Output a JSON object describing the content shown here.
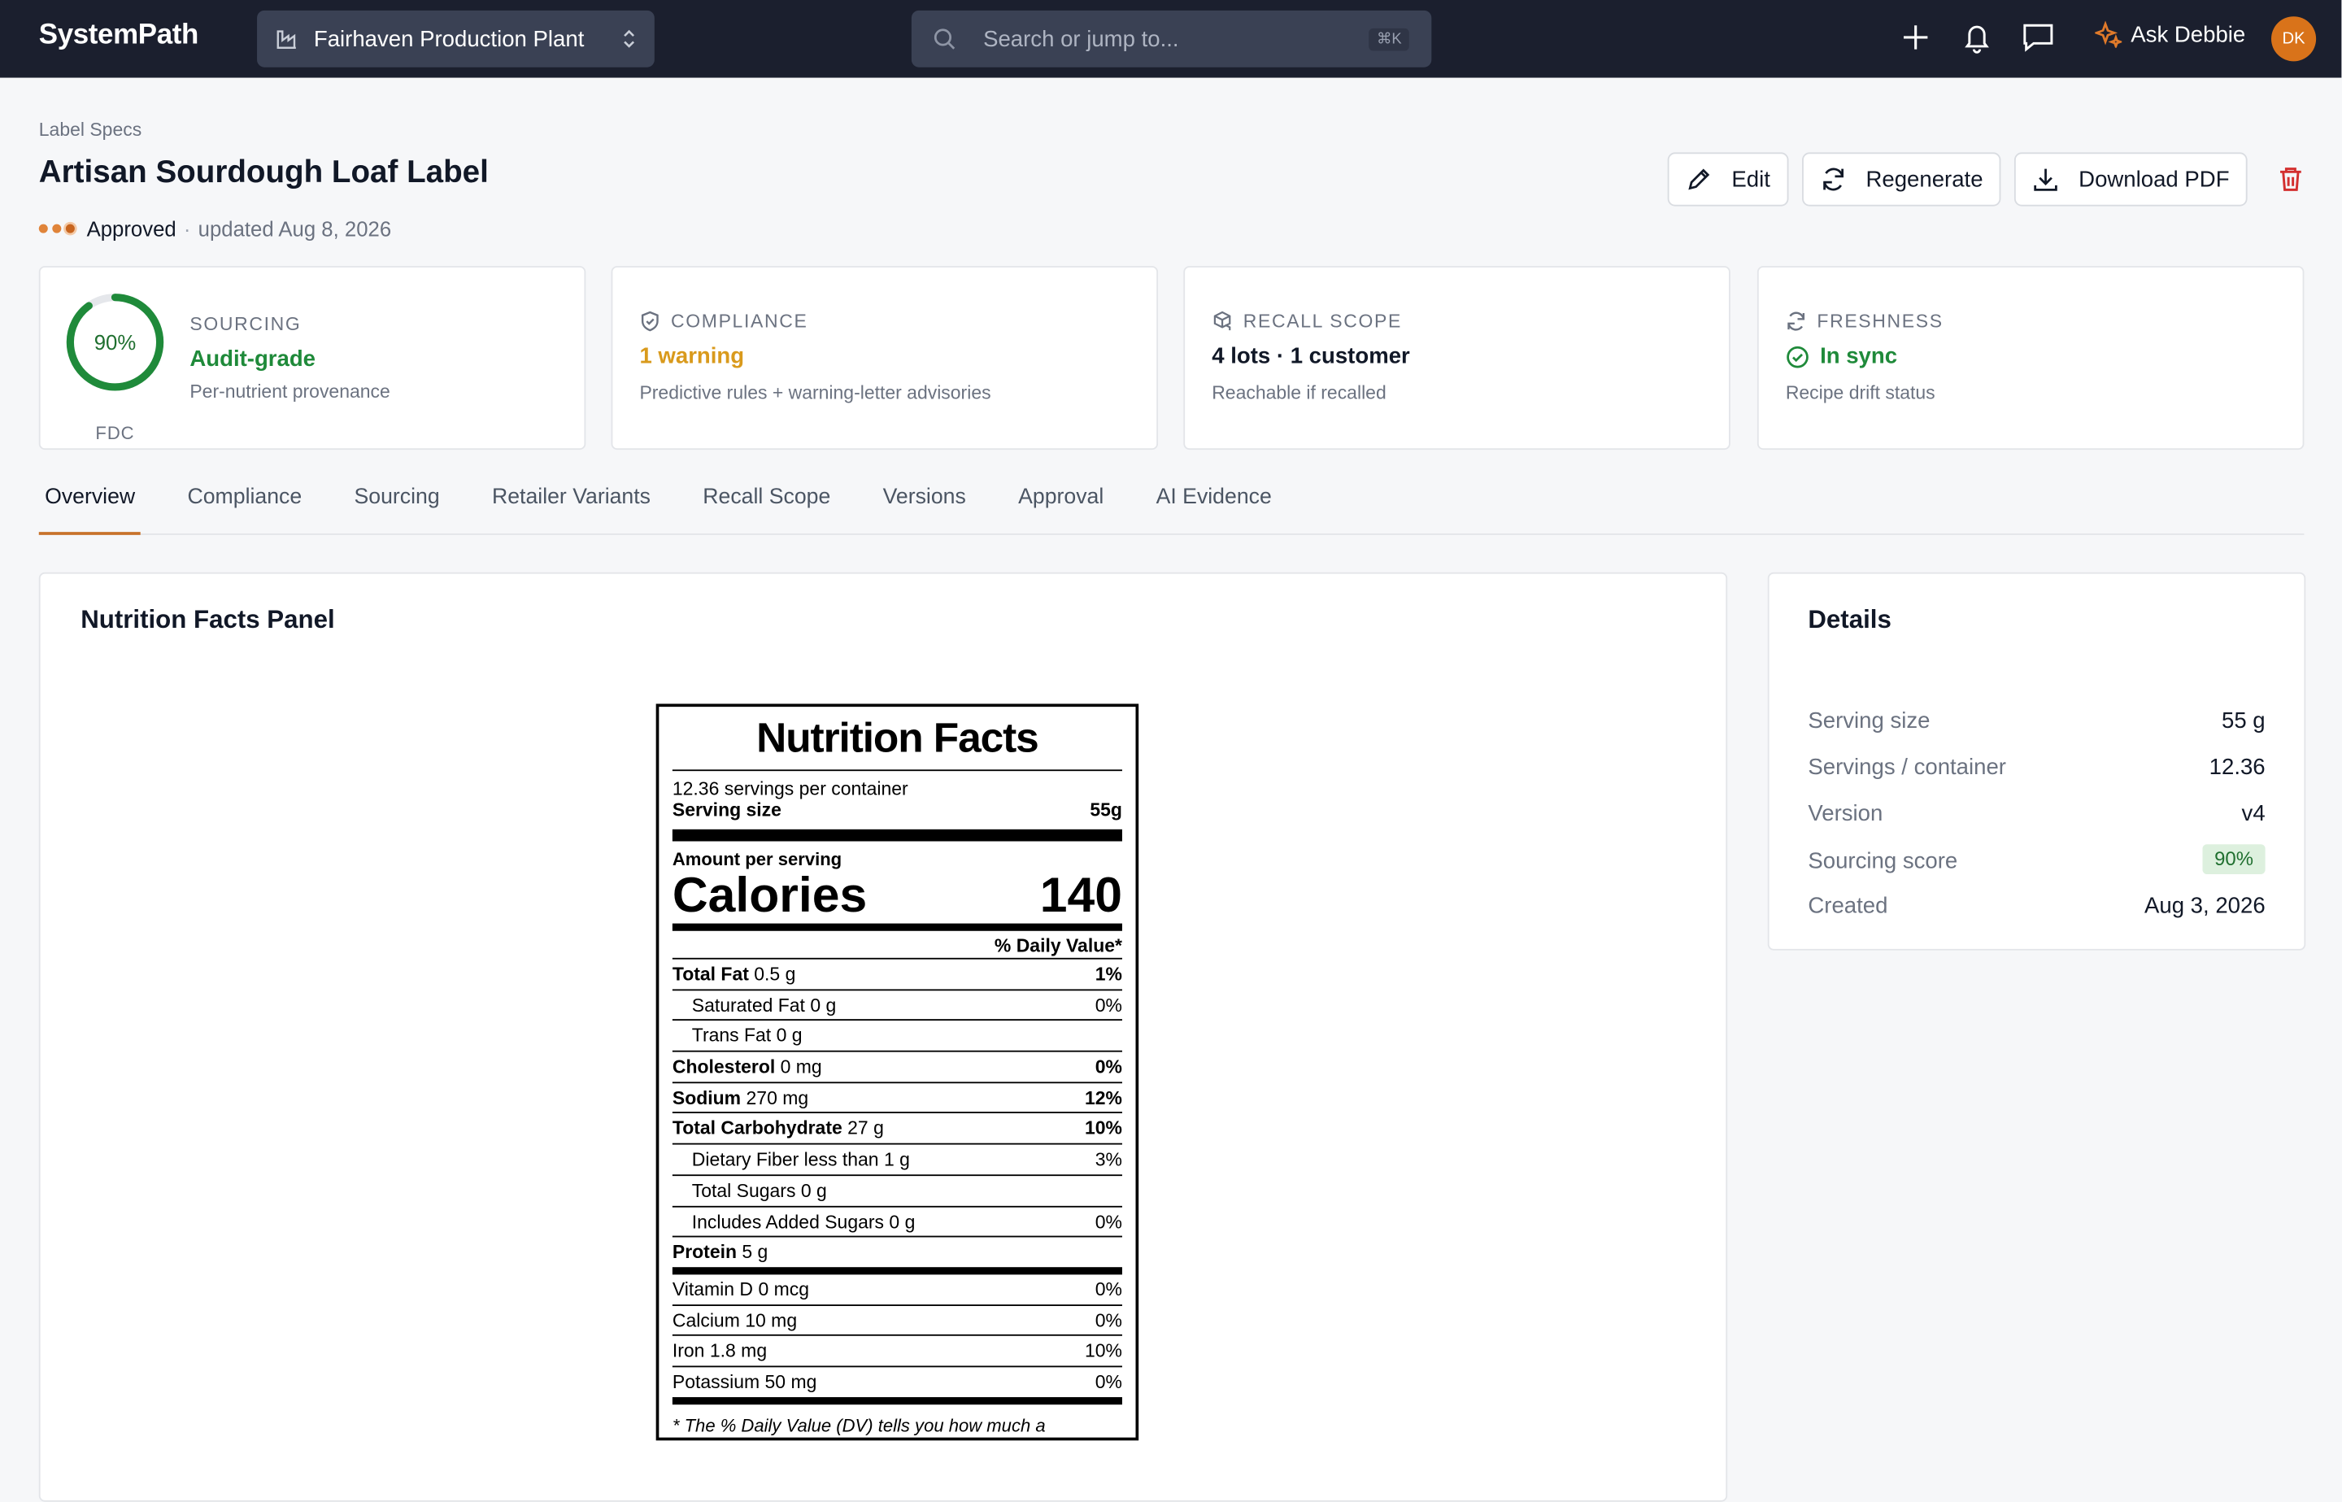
{
  "topbar": {
    "logo": "SystemPath",
    "plant_name": "Fairhaven Production Plant",
    "search_placeholder": "Search or jump to...",
    "search_shortcut": "⌘K",
    "assistant_label": "Ask Debbie",
    "avatar_initials": "DK"
  },
  "header": {
    "breadcrumb": "Label Specs",
    "title": "Artisan Sourdough Loaf Label",
    "status": "Approved",
    "status_sep": "·",
    "updated": "updated Aug 8, 2026",
    "actions": {
      "edit": "Edit",
      "regenerate": "Regenerate",
      "download": "Download PDF"
    }
  },
  "cards": {
    "sourcing": {
      "pct_label": "90%",
      "pct_value": 0.9,
      "ring_caption": "FDC",
      "label": "SOURCING",
      "value": "Audit-grade",
      "sub": "Per-nutrient provenance"
    },
    "compliance": {
      "label": "COMPLIANCE",
      "value": "1 warning",
      "sub": "Predictive rules + warning-letter advisories"
    },
    "recall": {
      "label": "RECALL SCOPE",
      "value": "4 lots · 1 customer",
      "sub": "Reachable if recalled"
    },
    "freshness": {
      "label": "FRESHNESS",
      "value": "In sync",
      "sub": "Recipe drift status"
    }
  },
  "tabs": [
    "Overview",
    "Compliance",
    "Sourcing",
    "Retailer Variants",
    "Recall Scope",
    "Versions",
    "Approval",
    "AI Evidence"
  ],
  "nutrition_panel": {
    "heading": "Nutrition Facts Panel",
    "title": "Nutrition Facts",
    "servings_per_container": "12.36 servings per container",
    "serving_size_label": "Serving size",
    "serving_size_value": "55g",
    "amount_per_serving": "Amount per serving",
    "calories_label": "Calories",
    "calories_value": "140",
    "dv_header": "% Daily Value*",
    "rows": [
      {
        "name": "Total Fat",
        "amount": "0.5 g",
        "dv": "1%"
      },
      {
        "name": "Saturated Fat",
        "amount": "0 g",
        "dv": "0%"
      },
      {
        "name": "Trans Fat",
        "amount": "0 g",
        "dv": ""
      },
      {
        "name": "Cholesterol",
        "amount": "0 mg",
        "dv": "0%"
      },
      {
        "name": "Sodium",
        "amount": "270 mg",
        "dv": "12%"
      },
      {
        "name": "Total Carbohydrate",
        "amount": "27 g",
        "dv": "10%"
      },
      {
        "name": "Dietary Fiber",
        "amount": "less than 1 g",
        "dv": "3%"
      },
      {
        "name": "Total Sugars",
        "amount": "0 g",
        "dv": ""
      },
      {
        "name": "Includes Added Sugars",
        "amount": "0 g",
        "dv": "0%"
      },
      {
        "name": "Protein",
        "amount": "5 g",
        "dv": ""
      },
      {
        "name": "Vitamin D",
        "amount": "0 mcg",
        "dv": "0%"
      },
      {
        "name": "Calcium",
        "amount": "10 mg",
        "dv": "0%"
      },
      {
        "name": "Iron",
        "amount": "1.8 mg",
        "dv": "10%"
      },
      {
        "name": "Potassium",
        "amount": "50 mg",
        "dv": "0%"
      }
    ],
    "footnote": "* The % Daily Value (DV) tells you how much a"
  },
  "details": {
    "heading": "Details",
    "rows": [
      {
        "label": "Serving size",
        "value": "55 g"
      },
      {
        "label": "Servings / container",
        "value": "12.36"
      },
      {
        "label": "Version",
        "value": "v4"
      },
      {
        "label": "Sourcing score",
        "value": "90%"
      },
      {
        "label": "Created",
        "value": "Aug 3, 2026"
      }
    ]
  },
  "colors": {
    "brand_accent": "#c8722a",
    "topbar_bg": "#1b1f2e",
    "success": "#1f8a3a",
    "warning": "#d99a1c",
    "danger": "#d32f2f"
  }
}
